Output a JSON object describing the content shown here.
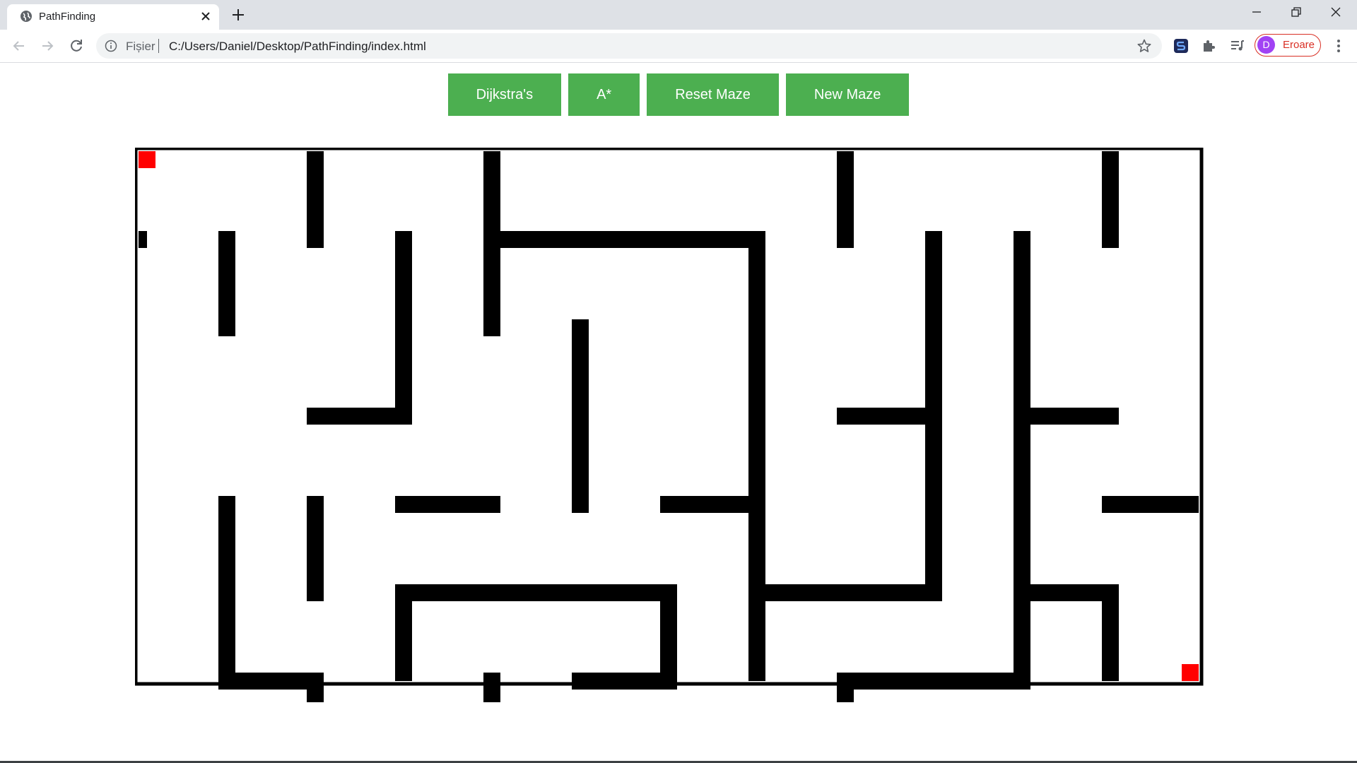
{
  "browser": {
    "tab_title": "PathFinding",
    "address_scheme": "Fișier",
    "address_url": "C:/Users/Daniel/Desktop/PathFinding/index.html",
    "profile_initial": "D",
    "profile_label": "Eroare",
    "icons": [
      "globe-icon",
      "close-icon",
      "plus-icon",
      "minimize-icon",
      "restore-icon",
      "close-window-icon",
      "back-arrow-icon",
      "forward-arrow-icon",
      "reload-icon",
      "info-icon",
      "star-icon",
      "extension-s-icon",
      "puzzle-icon",
      "media-queue-icon",
      "more-vert-icon"
    ],
    "accent_color": "#a142f4",
    "error_color": "#d93025"
  },
  "controls": {
    "dijkstra_label": "Dijkstra's",
    "astar_label": "A*",
    "reset_label": "Reset Maze",
    "new_label": "New Maze",
    "button_color": "#4caf50"
  },
  "maze": {
    "cols": 12,
    "rows": 6,
    "start_cell": [
      0,
      0
    ],
    "end_cell": [
      11,
      5
    ],
    "marker_color": "#ff0000",
    "wall_color": "#000000",
    "horizontal_walls": [
      [
        0,
        1,
        0,
        2
      ],
      [
        2,
        3,
        3,
        3
      ],
      [
        4,
        1,
        7,
        1
      ],
      [
        5,
        3,
        5,
        5
      ],
      [
        8,
        3,
        9,
        3
      ],
      [
        10,
        3,
        11,
        3
      ],
      [
        3,
        4,
        4,
        4
      ],
      [
        6,
        4,
        7,
        4
      ],
      [
        11,
        4,
        12,
        4
      ],
      [
        3,
        5,
        6,
        5
      ],
      [
        7,
        5,
        9,
        5
      ],
      [
        10,
        5,
        11,
        5
      ],
      [
        1,
        6,
        2,
        6
      ],
      [
        5,
        6,
        6,
        6
      ],
      [
        8,
        6,
        10,
        6
      ]
    ],
    "vertical_walls": [
      [
        2,
        0,
        2,
        1
      ],
      [
        4,
        0,
        4,
        2
      ],
      [
        8,
        0,
        8,
        1
      ],
      [
        11,
        0,
        11,
        1
      ],
      [
        1,
        1,
        1,
        2
      ],
      [
        3,
        1,
        3,
        3
      ],
      [
        7,
        1,
        7,
        6
      ],
      [
        9,
        1,
        9,
        5
      ],
      [
        10,
        1,
        10,
        6
      ],
      [
        5,
        2,
        5,
        4
      ],
      [
        1,
        4,
        1,
        6
      ],
      [
        2,
        4,
        2,
        5
      ],
      [
        6,
        5,
        6,
        6
      ],
      [
        11,
        5,
        11,
        6
      ],
      [
        3,
        5,
        3,
        6
      ],
      [
        2,
        6,
        2,
        7
      ],
      [
        4,
        6,
        4,
        7
      ],
      [
        8,
        6,
        8,
        7
      ]
    ]
  }
}
